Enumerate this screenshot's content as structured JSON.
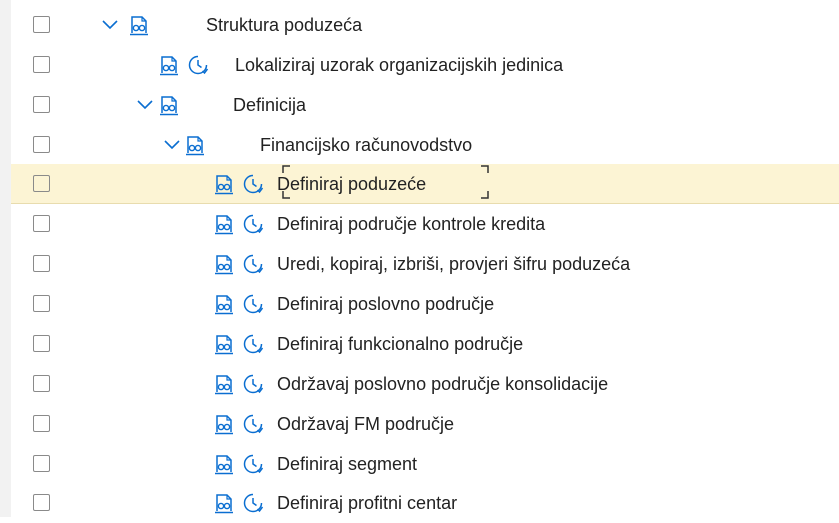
{
  "tree": {
    "rows": [
      {
        "label": "Struktura poduzeća",
        "level": 0,
        "expanded": true,
        "clock": false
      },
      {
        "label": "Lokaliziraj uzorak organizacijskih jedinica",
        "level": 1,
        "expanded": false,
        "clock": true
      },
      {
        "label": "Definicija",
        "level": 1,
        "expanded": true,
        "clock": false
      },
      {
        "label": "Financijsko računovodstvo",
        "level": 2,
        "expanded": true,
        "clock": false
      },
      {
        "label": "Definiraj poduzeće",
        "level": 3,
        "expanded": false,
        "clock": true,
        "selected": true
      },
      {
        "label": "Definiraj područje kontrole kredita",
        "level": 3,
        "expanded": false,
        "clock": true
      },
      {
        "label": "Uredi, kopiraj, izbriši, provjeri šifru poduzeća",
        "level": 3,
        "expanded": false,
        "clock": true
      },
      {
        "label": "Definiraj poslovno područje",
        "level": 3,
        "expanded": false,
        "clock": true
      },
      {
        "label": "Definiraj funkcionalno područje",
        "level": 3,
        "expanded": false,
        "clock": true
      },
      {
        "label": "Održavaj poslovno područje konsolidacije",
        "level": 3,
        "expanded": false,
        "clock": true
      },
      {
        "label": "Održavaj FM područje",
        "level": 3,
        "expanded": false,
        "clock": true
      },
      {
        "label": "Definiraj segment",
        "level": 3,
        "expanded": false,
        "clock": true
      },
      {
        "label": "Definiraj profitni centar",
        "level": 3,
        "expanded": false,
        "clock": true
      }
    ]
  },
  "colors": {
    "icon": "#0a6ed1",
    "selected_bg": "#fcf4d4"
  },
  "icons": {
    "expander": "chevron-down-icon",
    "document": "document-glasses-icon",
    "activity": "clock-icon"
  }
}
